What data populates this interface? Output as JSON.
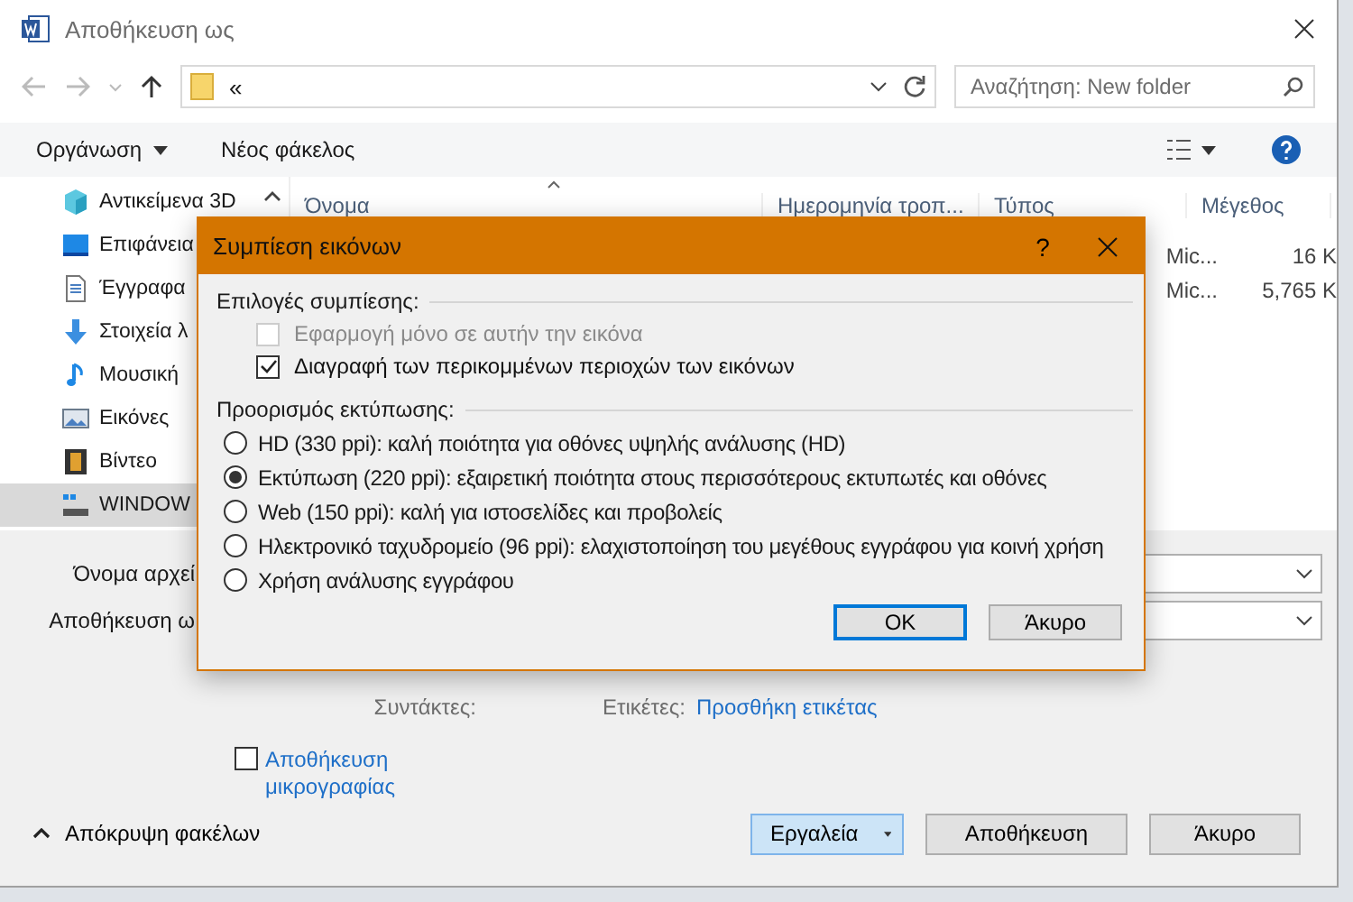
{
  "window": {
    "title": "Αποθήκευση ως"
  },
  "address": {
    "path": "«"
  },
  "search": {
    "placeholder": "Αναζήτηση: New folder"
  },
  "toolbar": {
    "organize": "Οργάνωση",
    "new_folder": "Νέος φάκελος"
  },
  "sidebar": {
    "items": [
      {
        "label": "Αντικείμενα 3D",
        "kind": "cube",
        "selected": false
      },
      {
        "label": "Επιφάνεια",
        "kind": "desktop",
        "selected": false
      },
      {
        "label": "Έγγραφα",
        "kind": "document",
        "selected": false
      },
      {
        "label": "Στοιχεία λ",
        "kind": "download",
        "selected": false
      },
      {
        "label": "Μουσική",
        "kind": "music",
        "selected": false
      },
      {
        "label": "Εικόνες",
        "kind": "pictures",
        "selected": false
      },
      {
        "label": "Βίντεο",
        "kind": "video",
        "selected": false
      },
      {
        "label": "WINDOW",
        "kind": "drive",
        "selected": true
      }
    ]
  },
  "columns": [
    "Όνομα",
    "Ημερομηνία τροπ...",
    "Τύπος",
    "Μέγεθος"
  ],
  "rows": [
    {
      "type": "Mic...",
      "size": "16 K"
    },
    {
      "type": "Mic...",
      "size": "5,765 K"
    }
  ],
  "form": {
    "filename_label": "Όνομα αρχεί",
    "savetype_label": "Αποθήκευση ω",
    "authors_label": "Συντάκτες:",
    "tags_label": "Ετικέτες:",
    "tags_link": "Προσθήκη ετικέτας"
  },
  "thumbnail": {
    "label": "Αποθήκευση μικρογραφίας",
    "checked": false
  },
  "hide_folders": "Απόκρυψη φακέλων",
  "buttons": {
    "tools": "Εργαλεία",
    "save": "Αποθήκευση",
    "cancel": "Άκυρο"
  },
  "modal": {
    "title": "Συμπίεση εικόνων",
    "help": "?",
    "options_heading": "Επιλογές συμπίεσης:",
    "checks": [
      {
        "label": "Εφαρμογή μόνο σε αυτήν την εικόνα",
        "checked": false,
        "disabled": true
      },
      {
        "label": "Διαγραφή των περικομμένων περιοχών των εικόνων",
        "checked": true,
        "disabled": false
      }
    ],
    "target_heading": "Προορισμός εκτύπωσης:",
    "resolutions": [
      {
        "label": "HD (330 ppi): καλή ποιότητα για οθόνες υψηλής ανάλυσης (HD)",
        "selected": false
      },
      {
        "label": "Εκτύπωση (220 ppi): εξαιρετική ποιότητα στους περισσότερους εκτυπωτές και οθόνες",
        "selected": true
      },
      {
        "label": "Web (150 ppi): καλή για ιστοσελίδες και προβολείς",
        "selected": false
      },
      {
        "label": "Ηλεκτρονικό ταχυδρομείο (96 ppi): ελαχιστοποίηση του μεγέθους εγγράφου για κοινή χρήση",
        "selected": false
      },
      {
        "label": "Χρήση ανάλυσης εγγράφου",
        "selected": false
      }
    ],
    "ok": "OK",
    "cancel": "Άκυρο"
  }
}
